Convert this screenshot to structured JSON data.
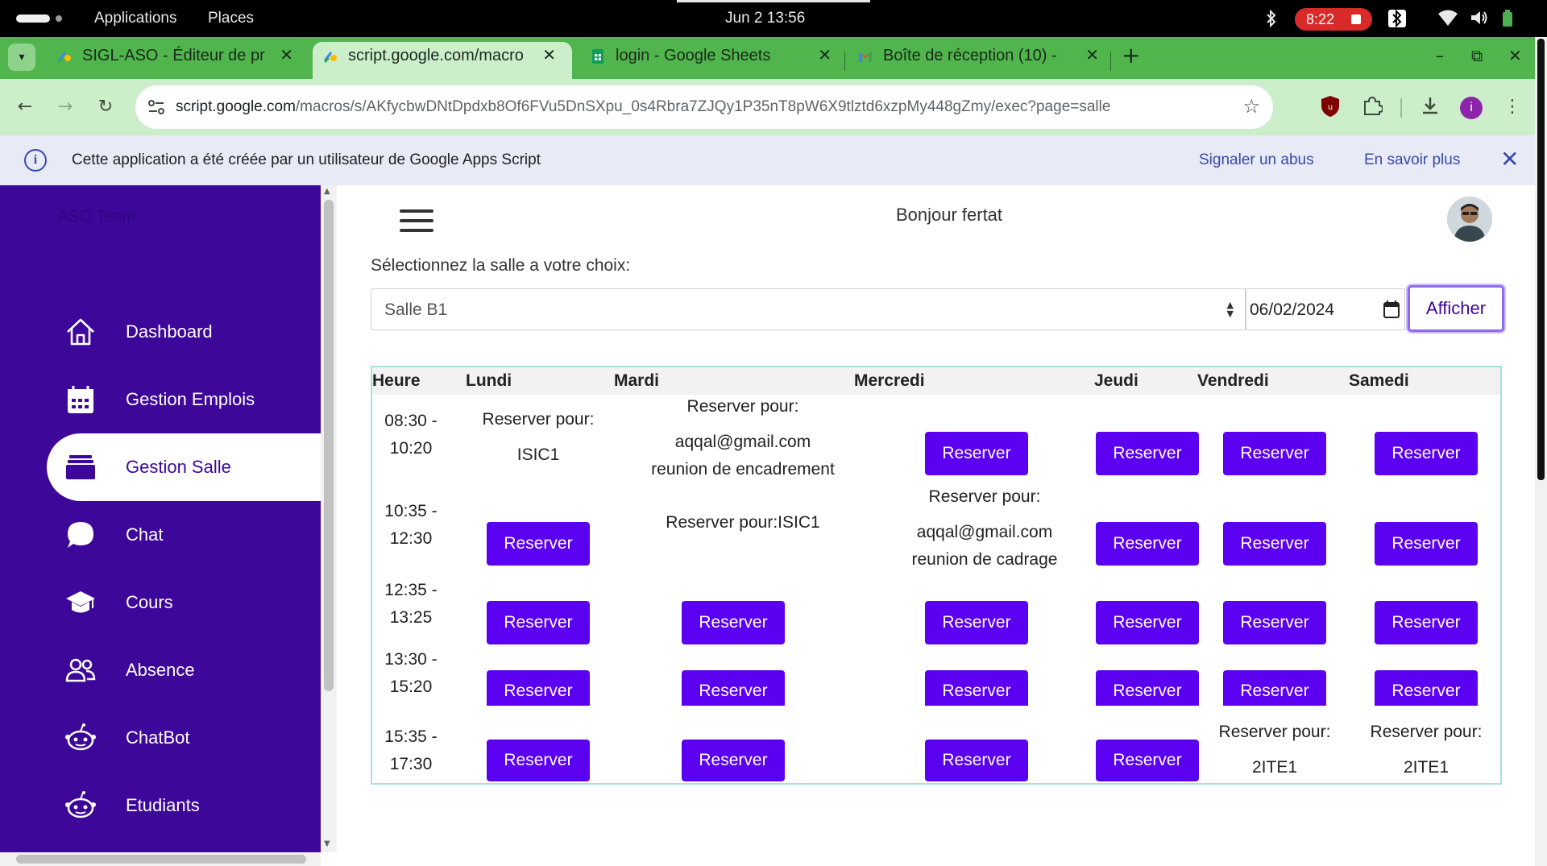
{
  "os_bar": {
    "menu": [
      "Applications",
      "Places"
    ],
    "clock": "Jun 2  13:56",
    "recording_time": "8:22"
  },
  "tabs": [
    {
      "title": "SIGL-ASO - Éditeur de pr",
      "icon": "apps-script-icon",
      "active": false
    },
    {
      "title": "script.google.com/macro",
      "icon": "apps-script-icon",
      "active": true
    },
    {
      "title": "login - Google Sheets",
      "icon": "sheets-icon",
      "active": false
    },
    {
      "title": "Boîte de réception (10) -",
      "icon": "gmail-icon",
      "active": false
    }
  ],
  "address_bar": {
    "host": "script.google.com",
    "path": "/macros/s/AKfycbwDNtDpdxb8Of6FVu5DnSXpu_0s4Rbra7ZJQy1P35nT8pW6X9tlztd6xzpMy448gZmy/exec?page=salle"
  },
  "profile_initial": "i",
  "info_bar": {
    "message": "Cette application a été créée par un utilisateur de Google Apps Script",
    "report_link": "Signaler un abus",
    "learn_link": "En savoir plus"
  },
  "sidebar": {
    "brand": "ASO Team",
    "items": [
      {
        "label": "Dashboard",
        "icon": "home-icon"
      },
      {
        "label": "Gestion Emplois",
        "icon": "calendar-icon"
      },
      {
        "label": "Gestion Salle",
        "icon": "room-icon",
        "active": true
      },
      {
        "label": "Chat",
        "icon": "chat-icon"
      },
      {
        "label": "Cours",
        "icon": "graduation-cap-icon"
      },
      {
        "label": "Absence",
        "icon": "users-icon"
      },
      {
        "label": "ChatBot",
        "icon": "robot-icon"
      },
      {
        "label": "Etudiants",
        "icon": "robot-icon"
      }
    ]
  },
  "main": {
    "greeting": "Bonjour fertat",
    "select_label": "Sélectionnez la salle a votre choix:",
    "room_value": "Salle B1",
    "date_value": "06/02/2024",
    "show_button": "Afficher"
  },
  "schedule": {
    "headers": [
      "Heure",
      "Lundi",
      "Mardi",
      "Mercredi",
      "Jeudi",
      "Vendredi",
      "Samedi"
    ],
    "reserve_label": "Reserver",
    "rows": [
      {
        "start": "08:30 -",
        "end": "10:20"
      },
      {
        "start": "10:35 -",
        "end": "12:30"
      },
      {
        "start": "12:35 -",
        "end": "13:25"
      },
      {
        "start": "13:30 -",
        "end": "15:20"
      },
      {
        "start": "15:35 -",
        "end": "17:30"
      }
    ],
    "booked": {
      "r0_lundi": {
        "line1": "Reserver pour:",
        "line2": "ISIC1"
      },
      "r0_mardi": {
        "line1": "Reserver pour:",
        "line2": "aqqal@gmail.com",
        "line3": "reunion de encadrement"
      },
      "r1_mardi": {
        "line1": "Reserver pour:ISIC1"
      },
      "r1_mercredi": {
        "line1": "Reserver pour:",
        "line2": "aqqal@gmail.com",
        "line3": "reunion de cadrage"
      },
      "r4_vendredi": {
        "line1": "Reserver pour:",
        "line2": "2ITE1"
      },
      "r4_samedi": {
        "line1": "Reserver pour:",
        "line2": "2ITE1"
      }
    }
  },
  "colors": {
    "sidebar": "#3d0799",
    "reserve_button": "#5b00f0",
    "tab_strip": "#4fb54c",
    "toolbar": "#cdeecb"
  }
}
